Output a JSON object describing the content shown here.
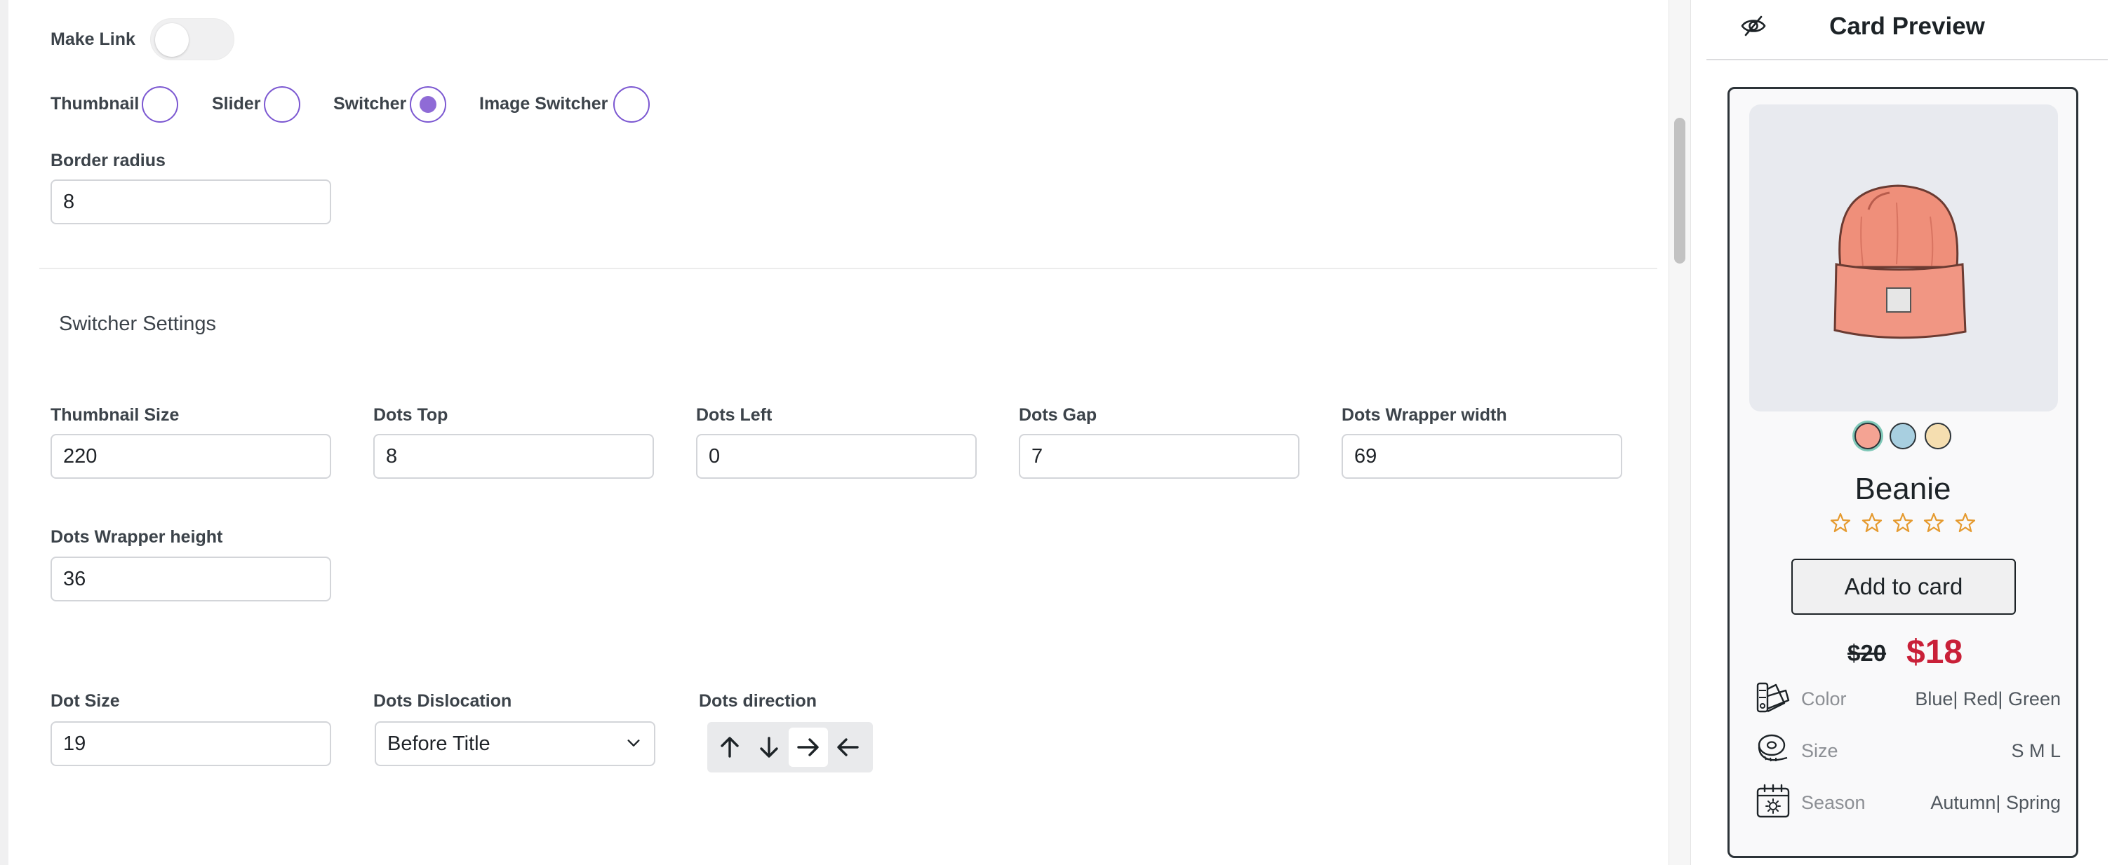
{
  "settings": {
    "make_link_label": "Make Link",
    "layout_options": [
      {
        "label": "Thumbnail",
        "checked": false
      },
      {
        "label": "Slider",
        "checked": false
      },
      {
        "label": "Switcher",
        "checked": true
      },
      {
        "label": "Image Switcher",
        "checked": false
      }
    ],
    "border_radius": {
      "label": "Border radius",
      "value": "8"
    },
    "switcher_section_title": "Switcher Settings",
    "thumbnail_size": {
      "label": "Thumbnail Size",
      "value": "220"
    },
    "dots_top": {
      "label": "Dots Top",
      "value": "8"
    },
    "dots_left": {
      "label": "Dots Left",
      "value": "0"
    },
    "dots_gap": {
      "label": "Dots Gap",
      "value": "7"
    },
    "dots_wrapper_width": {
      "label": "Dots Wrapper width",
      "value": "69"
    },
    "dots_wrapper_height": {
      "label": "Dots Wrapper height",
      "value": "36"
    },
    "dot_size": {
      "label": "Dot Size",
      "value": "19"
    },
    "dots_dislocation": {
      "label": "Dots Dislocation",
      "value": "Before Title"
    },
    "dots_direction": {
      "label": "Dots direction",
      "options": [
        "arrow-up-icon",
        "arrow-down-icon",
        "arrow-right-icon",
        "arrow-left-icon"
      ],
      "active": "arrow-right-icon"
    },
    "accent_color": "#8f6bd6"
  },
  "preview": {
    "title": "Card Preview",
    "product": {
      "name": "Beanie",
      "color_dots": [
        "#f4a393",
        "#a8cfe0",
        "#f5deb0"
      ],
      "selected_dot": 0,
      "rating_stars": 5,
      "button_label": "Add to card",
      "old_price": "$20",
      "new_price": "$18",
      "attributes": [
        {
          "icon": "swatch-icon",
          "name": "Color",
          "value": "Blue| Red| Green"
        },
        {
          "icon": "measuring-tape-icon",
          "name": "Size",
          "value": "S M L"
        },
        {
          "icon": "calendar-icon",
          "name": "Season",
          "value": "Autumn| Spring"
        }
      ]
    },
    "sale_color": "#c92038",
    "star_color": "#e59a2f"
  }
}
